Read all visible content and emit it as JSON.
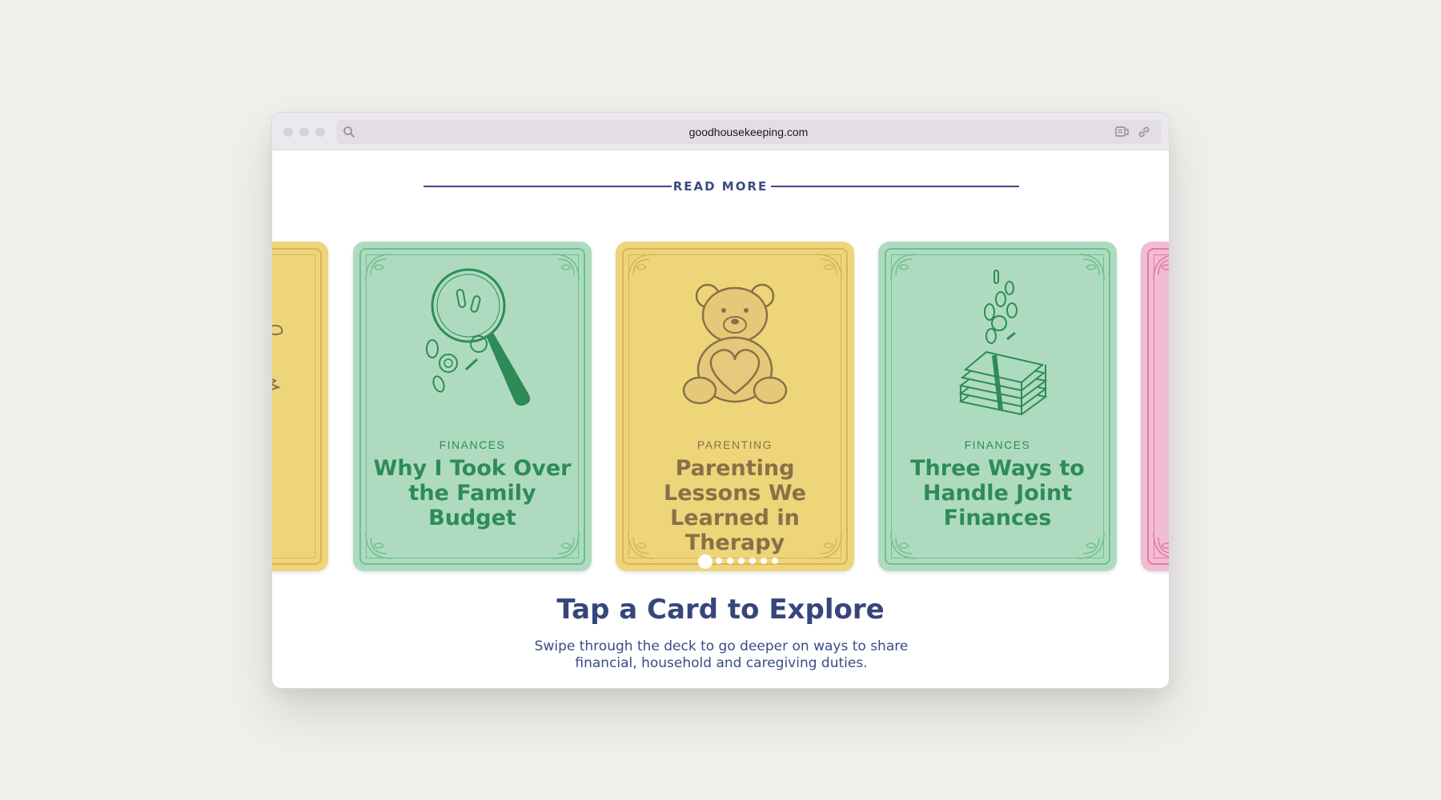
{
  "browser": {
    "url": "goodhousekeeping.com",
    "icons": [
      "search-icon",
      "reader-icon",
      "link-icon"
    ]
  },
  "section": {
    "heading": "READ MORE"
  },
  "cards": [
    {
      "color": "#eed57a",
      "category": "",
      "title": "",
      "icon": "partial-card-icon"
    },
    {
      "color": "#aedbbf",
      "category": "FINANCES",
      "title": "Why I Took Over the Family Budget",
      "icon": "magnifying-glass-coins-icon"
    },
    {
      "color": "#eed57a",
      "category": "PARENTING",
      "title": "Parenting Lessons We Learned in Therapy",
      "icon": "teddy-bear-heart-icon"
    },
    {
      "color": "#aedbbf",
      "category": "FINANCES",
      "title": "Three Ways to Handle Joint Finances",
      "icon": "money-stack-coins-icon"
    },
    {
      "color": "#f0bdd4",
      "category": "",
      "title": "",
      "icon": "partial-card-icon"
    }
  ],
  "pager": {
    "count": 7,
    "active": 1
  },
  "cta": {
    "title": "Tap a Card to Explore",
    "subtitle": "Swipe through the deck to go deeper on ways to share financial, household and caregiving duties."
  }
}
